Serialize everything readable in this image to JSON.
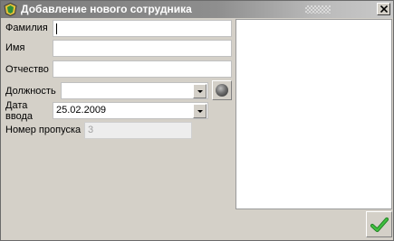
{
  "window": {
    "title": "Добавление нового сотрудника"
  },
  "form": {
    "surname": {
      "label": "Фамилия",
      "value": ""
    },
    "name": {
      "label": "Имя",
      "value": ""
    },
    "patronymic": {
      "label": "Отчество",
      "value": ""
    },
    "position": {
      "label": "Должность",
      "value": ""
    },
    "date": {
      "label_line1": "Дата",
      "label_line2": "ввода",
      "value": "25.02.2009"
    },
    "pass_number": {
      "label": "Номер пропуска",
      "value": "3"
    }
  },
  "icons": {
    "app": "app-icon",
    "close": "close-icon",
    "dropdown": "chevron-down-icon",
    "orb": "orb-icon",
    "confirm": "checkmark-icon"
  },
  "colors": {
    "window_bg": "#d4d0c8",
    "titlebar": "#8e8e8e",
    "confirm_check": "#2fa82f"
  }
}
